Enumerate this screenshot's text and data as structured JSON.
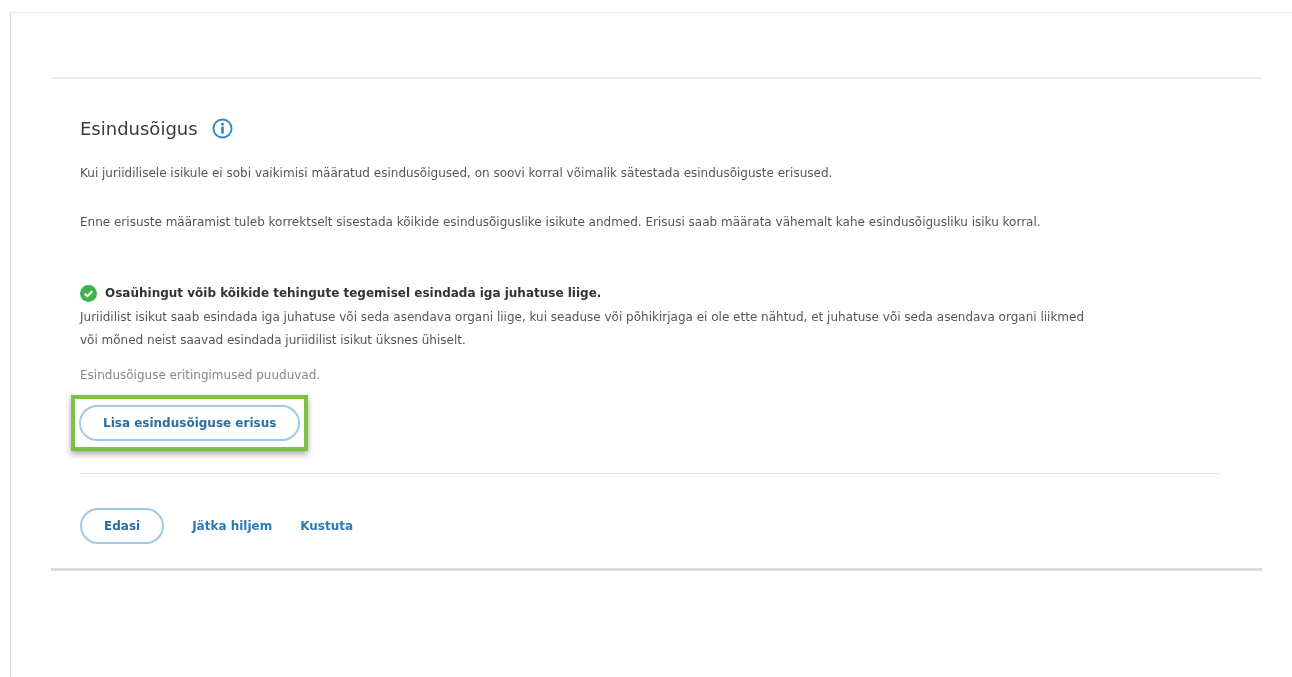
{
  "section": {
    "title": "Esindusõigus",
    "paragraphs": [
      "Kui juriidilisele isikule ei sobi vaikimisi määratud esindusõigused, on soovi korral võimalik sätestada esindusõiguste erisused.",
      "Enne erisuste määramist tuleb korrektselt sisestada kõikide esindusõiguslike isikute andmed. Erisusi saab määrata vähemalt kahe esindusõigusliku isiku korral."
    ]
  },
  "status": {
    "kind": "success",
    "title": "Osaühingut võib kõikide tehingute tegemisel esindada iga juhatuse liige.",
    "description": "Juriidilist isikut saab esindada iga juhatuse või seda asendava organi liige, kui seaduse või põhikirjaga ei ole ette nähtud, et juhatuse või seda asendava organi liikmed või mõned neist saavad esindada juriidilist isikut üksnes ühiselt.",
    "note": "Esindusõiguse eritingimused puuduvad."
  },
  "add_button": {
    "label": "Lisa esindusõiguse erisus",
    "highlighted": true
  },
  "actions": [
    {
      "kind": "button",
      "label": "Edasi"
    },
    {
      "kind": "link",
      "label": "Jätka hiljem"
    },
    {
      "kind": "link",
      "label": "Kustuta"
    }
  ]
}
